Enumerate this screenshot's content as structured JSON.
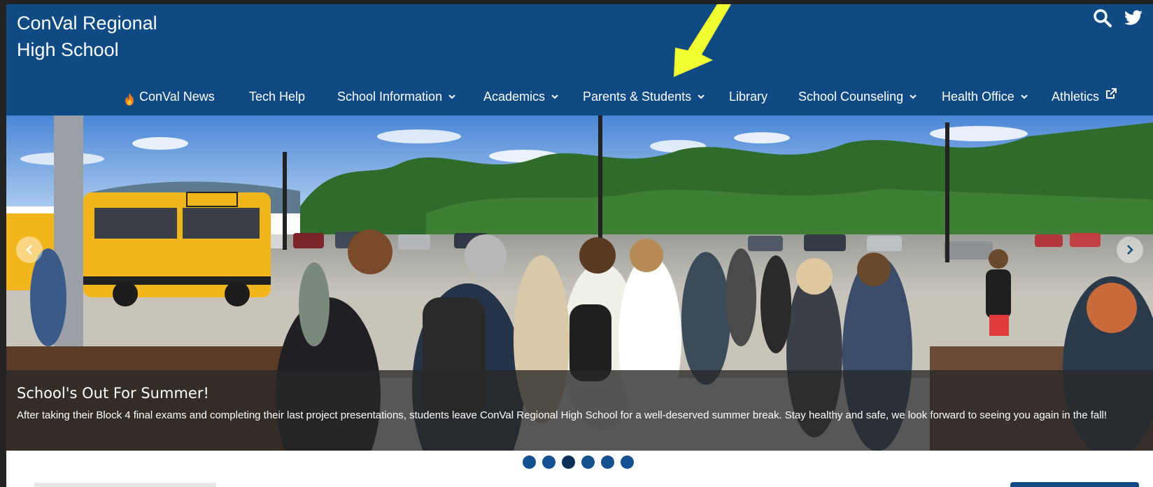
{
  "site": {
    "title": "ConVal Regional\nHigh School"
  },
  "header_icons": [
    "search-icon",
    "twitter-icon"
  ],
  "nav": {
    "items": [
      {
        "label": "ConVal News",
        "icon": "flame-icon",
        "dropdown": false
      },
      {
        "label": "Tech Help",
        "dropdown": false
      },
      {
        "label": "School Information",
        "dropdown": true
      },
      {
        "label": "Academics",
        "dropdown": true
      },
      {
        "label": "Parents & Students",
        "dropdown": true
      },
      {
        "label": "Library",
        "dropdown": false
      },
      {
        "label": "School Counseling",
        "dropdown": true
      },
      {
        "label": "Health Office",
        "dropdown": true
      },
      {
        "label": "Athletics",
        "external": true
      }
    ]
  },
  "hero": {
    "caption_title": "School's Out For Summer!",
    "caption_text": "After taking their Block 4 final exams and completing their last project presentations, students leave ConVal Regional High School for a well-deserved summer break. Stay healthy and safe, we look forward to seeing you again in the fall!",
    "slide_count": 6,
    "active_slide": 3
  },
  "colors": {
    "brand": "#0f4a85",
    "annotation_arrow": "#f2ff2e",
    "dot": "#12508f",
    "dot_active": "#0a2f57"
  }
}
